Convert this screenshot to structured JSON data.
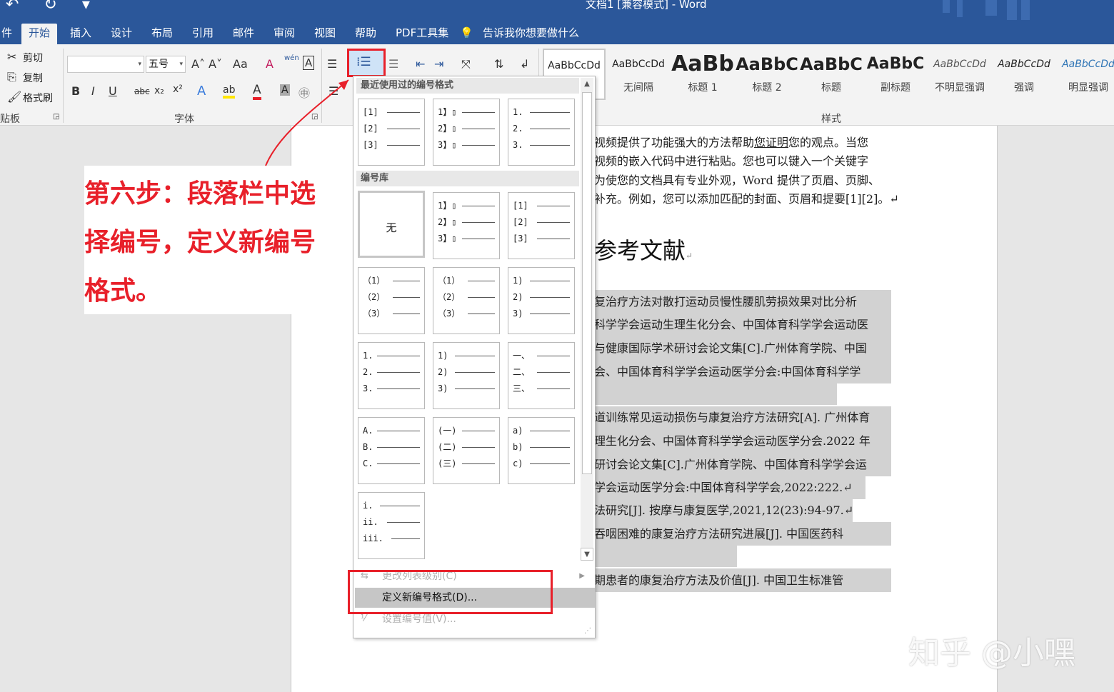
{
  "window": {
    "title": "文档1 [兼容模式] - Word",
    "quick_access": "↶ ↻ ▾"
  },
  "tabs": [
    "件",
    "开始",
    "插入",
    "设计",
    "布局",
    "引用",
    "邮件",
    "审阅",
    "视图",
    "帮助",
    "PDF工具集",
    "告诉我你想要做什么"
  ],
  "clipboard": {
    "cut": "剪切",
    "copy": "复制",
    "format_painter": "格式刷",
    "group_label": "剪贴板"
  },
  "font": {
    "font_name": "",
    "font_size": "五号",
    "grow": "A˄",
    "shrink": "A˅",
    "case": "Aa",
    "clear": "A",
    "phonetic": "wén",
    "border_char": "A",
    "bold": "B",
    "italic": "I",
    "underline": "U",
    "strike": "abc",
    "subscript": "x₂",
    "superscript": "x²",
    "effect": "A",
    "highlight": "ab",
    "font_color": "A",
    "char_shading": "A",
    "enclose": "㊥",
    "group_label": "字体"
  },
  "paragraph": {
    "bullets": "☰",
    "numbering": "⁞☰",
    "multilevel": "☰"
  },
  "styles": {
    "group_label": "样式",
    "items": [
      {
        "sample": "AaBbCcDd",
        "name": ""
      },
      {
        "sample": "AaBbCcDd",
        "name": "无间隔"
      },
      {
        "sample": "AaBb",
        "name": "标题 1"
      },
      {
        "sample": "AaBbC",
        "name": "标题 2"
      },
      {
        "sample": "AaBbC",
        "name": "标题"
      },
      {
        "sample": "AaBbC",
        "name": "副标题"
      },
      {
        "sample": "AaBbCcDd",
        "name": "不明显强调"
      },
      {
        "sample": "AaBbCcDd",
        "name": "强调"
      },
      {
        "sample": "AaBbCcDd",
        "name": "明显强调"
      }
    ]
  },
  "document": {
    "body_lines": [
      "视频提供了功能强大的方法帮助",
      "您证明",
      "您的观点。当您",
      "视频的嵌入代码中进行粘贴。您也可以键入一个关键字",
      "为使您的文档具有专业外观，Word 提供了页眉、页脚、",
      "补充。例如，您可以添加匹配的封面、页眉和提要[1][2]。↵"
    ],
    "heading": "参考文献",
    "heading_mark": "↵",
    "refs": [
      "复治疗方法对散打运动员慢性腰肌劳损效果对比分析",
      "科学学会运动生理生化分会、中国体育科学学会运动医",
      "与健康国际学术研讨会论文集[C].广州体育学院、中国",
      "会、中国体育科学学会运动医学分会:中国体育科学学",
      "道训练常见运动损伤与康复治疗方法研究[A]. 广州体育",
      "理生化分会、中国体育科学学会运动医学分会.2022 年",
      "研讨会论文集[C].广州体育学院、中国体育科学学会运",
      "学会运动医学分会:中国体育科学学会,2022:222.↵",
      "法研究[J]. 按摩与康复医学,2021,12(23):94-97.↵",
      "吞咽困难的康复治疗方法研究进展[J]. 中国医药科",
      "期患者的康复治疗方法及价值[J]. 中国卫生标准管"
    ]
  },
  "annotation": {
    "lines": [
      "第六步：段落栏中选",
      "择编号，定义新编号",
      "格式。"
    ]
  },
  "numbering_menu": {
    "recent_header": "最近使用过的编号格式",
    "library_header": "编号库",
    "none_label": "无",
    "recent": [
      [
        "[1]",
        "[2]",
        "[3]"
      ],
      [
        "1】▯",
        "2】▯",
        "3】▯"
      ],
      [
        "1.",
        "2.",
        "3."
      ]
    ],
    "library": [
      [
        "1】▯",
        "2】▯",
        "3】▯"
      ],
      [
        "[1]",
        "[2]",
        "[3]"
      ],
      [
        "（1）",
        "（2）",
        "（3）"
      ],
      [
        "（1）",
        "（2）",
        "（3）"
      ],
      [
        "1)",
        "2)",
        "3)"
      ],
      [
        "1.",
        "2.",
        "3."
      ],
      [
        "1)",
        "2)",
        "3)"
      ],
      [
        "一、",
        "二、",
        "三、"
      ],
      [
        "A.",
        "B.",
        "C."
      ],
      [
        "(一)",
        "(二)",
        "(三)"
      ],
      [
        "a)",
        "b)",
        "c)"
      ],
      [
        "i.",
        "ii.",
        "iii."
      ]
    ],
    "change_level": "更改列表级别(C)",
    "define_new": "定义新编号格式(D)...",
    "set_value": "设置编号值(V)..."
  },
  "watermark": "知乎 @小嘿",
  "colors": {
    "accent": "#2b579a",
    "callout": "#e8202a",
    "highlight": "#d2d2d2"
  }
}
